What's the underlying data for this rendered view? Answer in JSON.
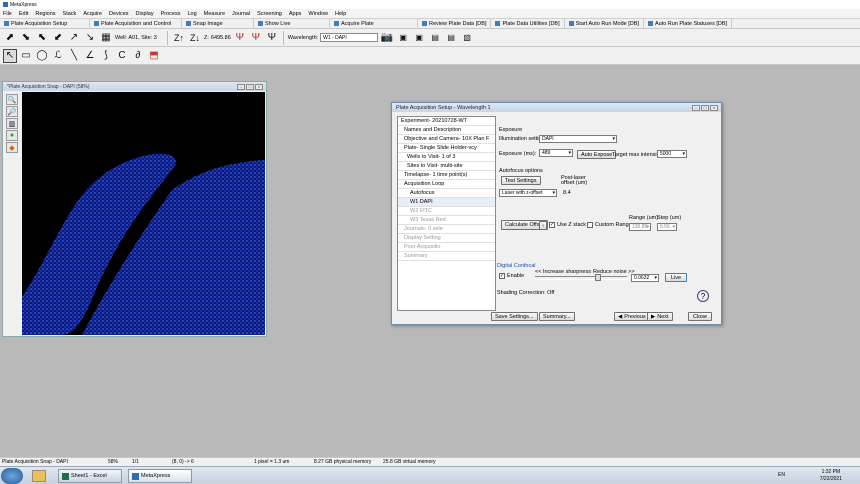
{
  "app": {
    "title": "MetaXpress"
  },
  "menu": [
    "File",
    "Edit",
    "Regions",
    "Stack",
    "Acquire",
    "Devices",
    "Display",
    "Process",
    "Log",
    "Measure",
    "Journal",
    "Screening",
    "Apps",
    "Window",
    "Help"
  ],
  "tasks": [
    "Plate Acquisition Setup",
    "Plate Acquisition and Control",
    "Snap Image",
    "Show Live",
    "Acquire Plate",
    "Review Plate Data [DB]",
    "Plate Data Utilities [DB]",
    "Start Auto Run Mode [DB]",
    "Auto Run Plate Statuses [DB]"
  ],
  "toolbar": {
    "well": "Well: A01, Site: 3",
    "z_label": "Z:",
    "z_value": "6495.86",
    "wavelength_label": "Wavelength:",
    "wavelength_value": "W1 - DAPI"
  },
  "image_window": {
    "title": "*Plate Acquisition Snap - DAPI (58%)"
  },
  "dialog": {
    "title": "Plate Acquisition Setup - Wavelength 1",
    "tree": [
      "Experiment- 20210728-WT",
      "Names and Description",
      "Objective and Camera- 10X Plan F",
      "Plate- Single Slide Holder-vcy",
      "Wells to Visit- 1 of 3",
      "Sites to Visit- multi-site",
      "Timelapse- 1 time point(s)",
      "Acquisition Loop",
      "Autofocus",
      "W1 DAPI",
      "W2 FITC",
      "W3 Texas Red",
      "Journals- 0 sele",
      "Display Setting",
      "Post-Acquisitio",
      "Summary"
    ],
    "exposure_heading": "Exposure",
    "illumination_label": "Illumination setting:",
    "illumination_value": "DAPI",
    "exposure_label": "Exposure (ms):",
    "exposure_value": "489",
    "auto_expose": "Auto Expose",
    "target_label": "Target max intensity:",
    "target_value": "5000",
    "autofocus_heading": "Autofocus options",
    "test_settings": "Test Settings",
    "laser_mode": "Laser with z-offset",
    "post_laser_label": "Post-laser offset (um)",
    "post_laser_value": "8.4",
    "calculate_offset": "Calculate Offset",
    "use_z_stack": "Use Z stack",
    "custom_range": "Custom Range",
    "range_label": "Range (um)",
    "range_value": "130.89",
    "step_label": "Step (um)",
    "step_value": "5.56",
    "confocal_heading": "Digital Confocal",
    "enable": "Enable",
    "sharpness": "<< Increase sharpness",
    "noise": "Reduce noise >>",
    "confocal_value": "0.0632",
    "live": "Live",
    "shading": "Shading Correction: Off",
    "save_settings": "Save Settings...",
    "summary": "Summary...",
    "previous": "Previous",
    "next": "Next",
    "close": "Close"
  },
  "status": {
    "name": "Plate Acquisition Snap - DAPI",
    "zoom": "58%",
    "frame": "1/1",
    "coords": "(8, 0) -> 6",
    "pixel": "1 pixel = 1.3 um",
    "phys_mem": "8.27 GB physical memory",
    "virt_mem": "25.8 GB virtual memory"
  },
  "taskbar": {
    "items": [
      "Sheet1 - Excel",
      "MetaXpress"
    ],
    "lang": "EN",
    "time": "1:32 PM",
    "date": "7/22/2021"
  }
}
